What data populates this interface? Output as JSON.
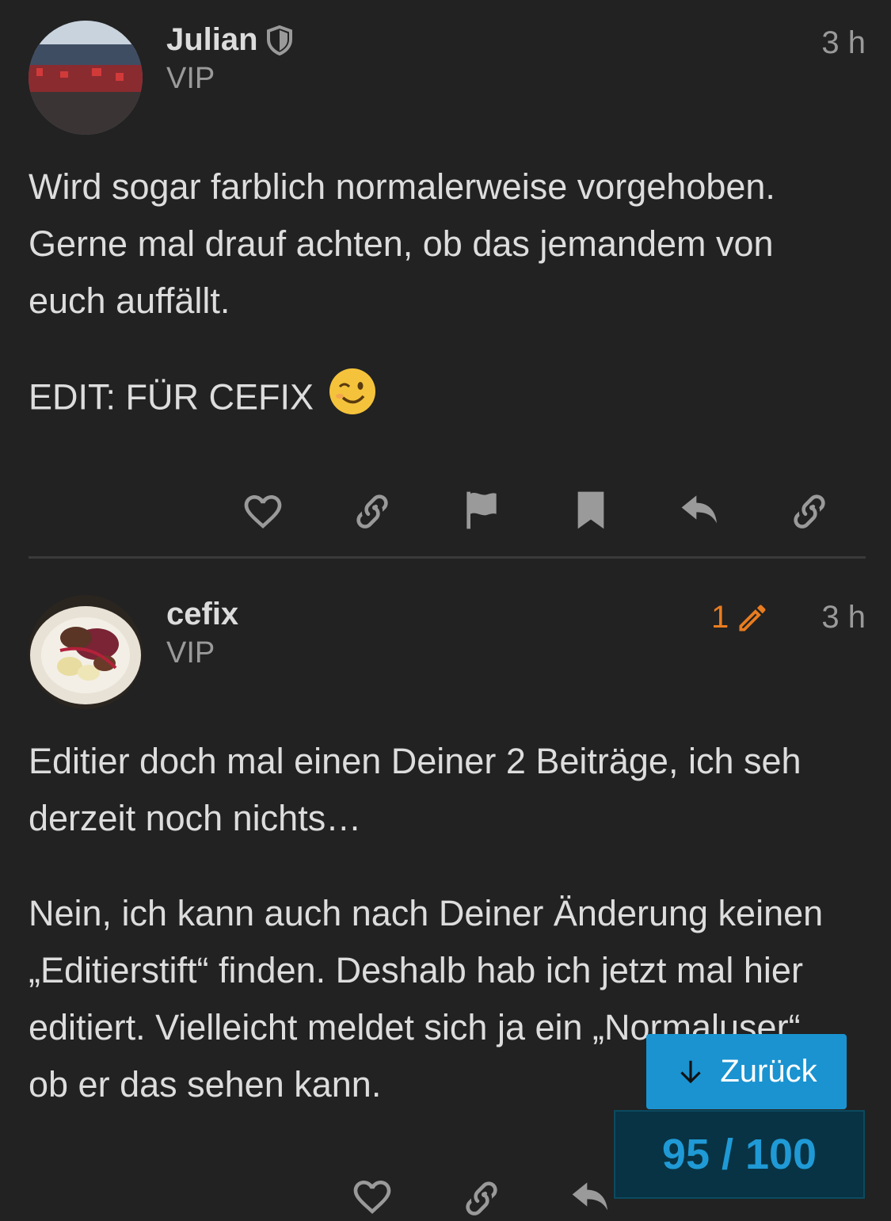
{
  "posts": [
    {
      "username": "Julian",
      "badge_icon": "shield-icon",
      "user_title": "VIP",
      "time": "3 h",
      "paragraphs": [
        "Wird sogar farblich normalerweise vorgehoben. Gerne mal drauf achten, ob das jemandem von euch auffällt.",
        "EDIT: FÜR CEFIX"
      ],
      "emoji": "😉",
      "actions": [
        "heart-icon",
        "link-icon",
        "flag-icon",
        "bookmark-icon",
        "reply-icon",
        "link-icon"
      ]
    },
    {
      "username": "cefix",
      "user_title": "VIP",
      "time": "3 h",
      "edit_count": "1",
      "paragraphs": [
        "Editier doch mal einen Deiner 2 Beiträge, ich seh derzeit noch nichts…",
        "Nein, ich kann auch nach Deiner Änderung keinen „Editierstift“ finden. Deshalb hab ich jetzt mal hier editiert. Vielleicht meldet sich ja ein „Normaluser“, ob er das sehen kann."
      ]
    }
  ],
  "back_button": {
    "label": "Zurück",
    "icon": "arrow-down-icon"
  },
  "progress": {
    "current": 95,
    "total": 100,
    "label": "95 / 100"
  },
  "colors": {
    "background": "#222222",
    "accent_blue": "#1a93d0",
    "edit_orange": "#e97c1f"
  }
}
